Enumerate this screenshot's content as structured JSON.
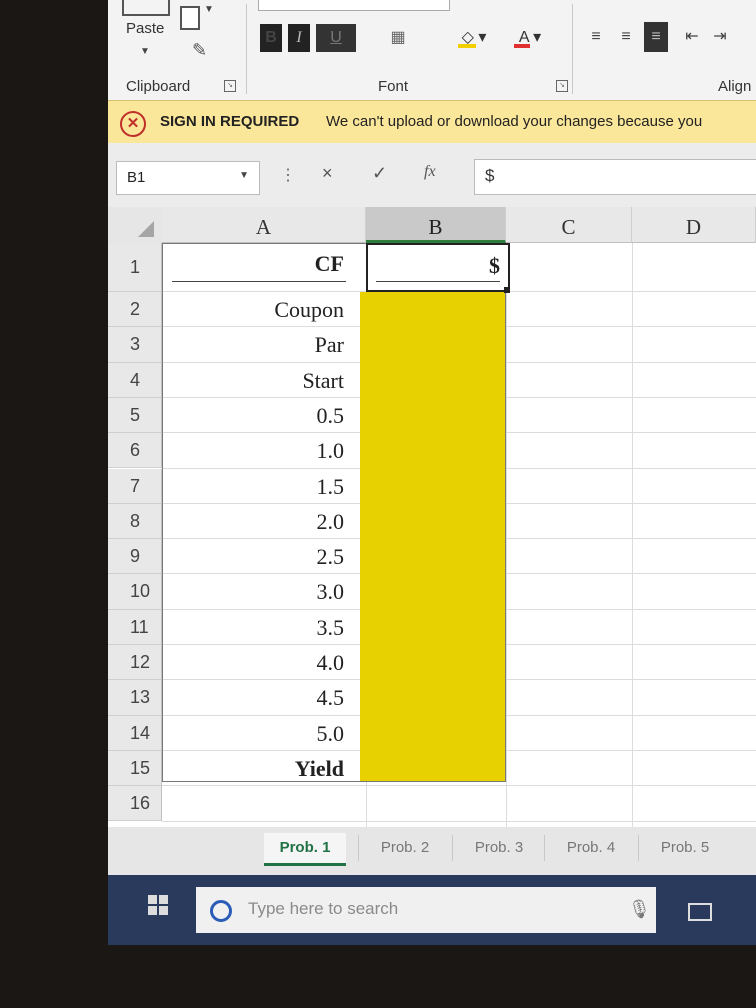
{
  "ribbon": {
    "paste_label": "Paste",
    "clipboard_label": "Clipboard",
    "font_label": "Font",
    "alignment_label": "Align",
    "bold": "B",
    "italic": "I",
    "underline": "U",
    "font_color": "A",
    "launcher": "↘"
  },
  "banner": {
    "title": "SIGN IN REQUIRED",
    "message": "We can't upload or download your changes because you"
  },
  "formula_bar": {
    "name_box": "B1",
    "cancel": "×",
    "enter": "✓",
    "fx": "fx",
    "value": "$"
  },
  "grid": {
    "columns": [
      "A",
      "B",
      "C",
      "D"
    ],
    "rows": [
      "1",
      "2",
      "3",
      "4",
      "5",
      "6",
      "7",
      "8",
      "9",
      "10",
      "11",
      "12",
      "13",
      "14",
      "15",
      "16"
    ],
    "column_a": [
      "CF",
      "Coupon",
      "Par",
      "Start",
      "0.5",
      "1.0",
      "1.5",
      "2.0",
      "2.5",
      "3.0",
      "3.5",
      "4.0",
      "4.5",
      "5.0",
      "Yield"
    ],
    "b1_value": "$",
    "fill_color": "#e8d100"
  },
  "sheets": {
    "tabs": [
      "Prob. 1",
      "Prob. 2",
      "Prob. 3",
      "Prob. 4",
      "Prob. 5"
    ],
    "active": "Prob. 1"
  },
  "taskbar": {
    "search_placeholder": "Type here to search"
  }
}
